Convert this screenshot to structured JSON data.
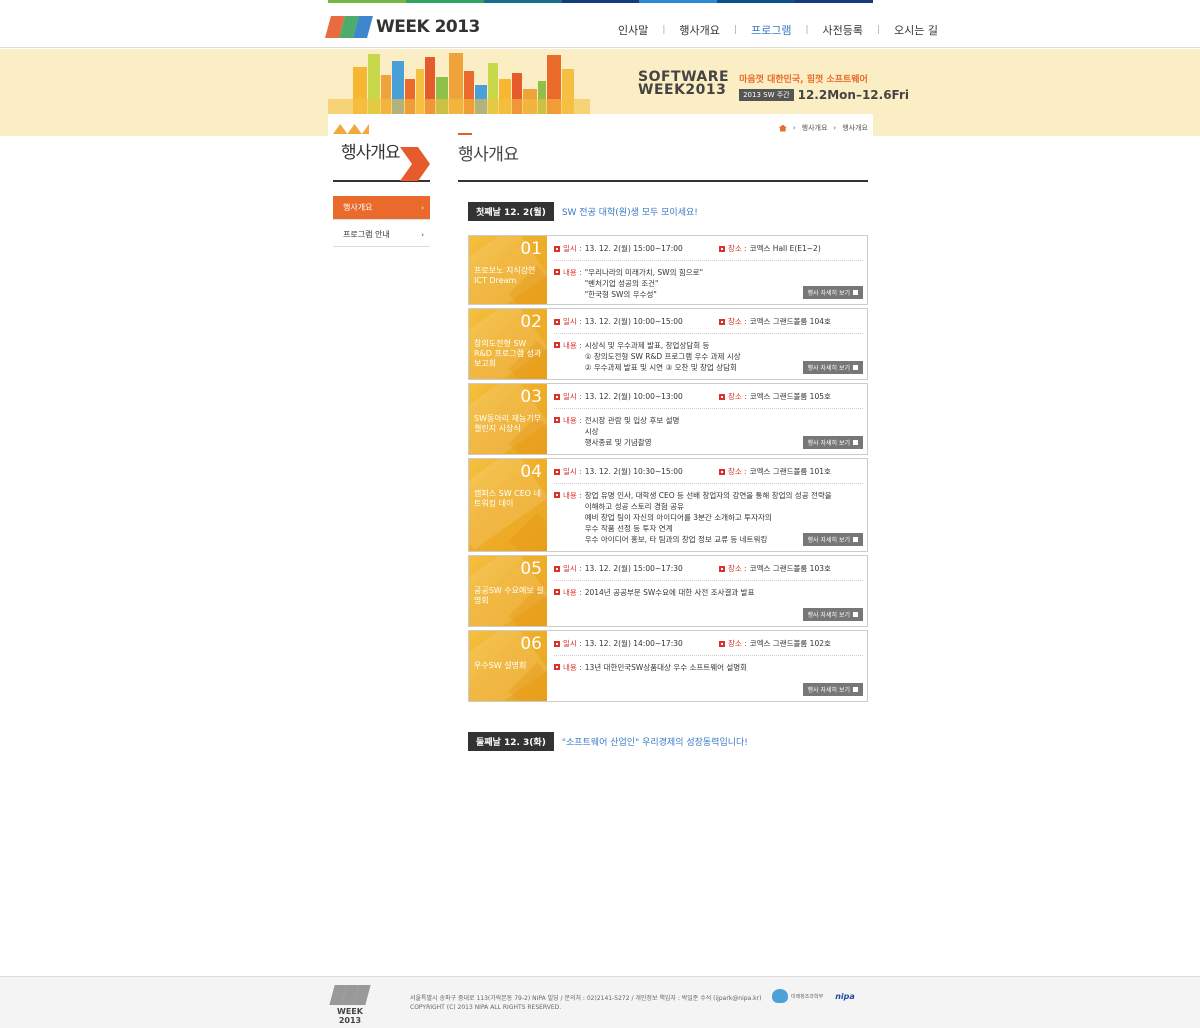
{
  "colors": {
    "accent": "#e96a2b",
    "link_blue": "#3a79c4",
    "label_red": "#d8322a",
    "banner_bg": "#fbeec5",
    "event_yellow": "#f0b02a",
    "strip": [
      "#74b743",
      "#31a45e",
      "#1a6e8c",
      "#133d7a",
      "#2a8bd2",
      "#0d4f8a",
      "#133d7a"
    ]
  },
  "header": {
    "logo_text": "WEEK 2013",
    "nav": [
      {
        "label": "인사말",
        "active": false
      },
      {
        "label": "행사개요",
        "active": false
      },
      {
        "label": "프로그램",
        "active": true
      },
      {
        "label": "사전등록",
        "active": false
      },
      {
        "label": "오시는 길",
        "active": false
      }
    ]
  },
  "banner": {
    "title_line1": "SOFTWARE",
    "title_line2": "WEEK2013",
    "slogan": "마음껏 대한민국, 힘껏 소프트웨어",
    "badge": "2013 SW 주간",
    "date": "12.2Mon–12.6Fri"
  },
  "breadcrumb": {
    "items": [
      "행사개요",
      "행사개요"
    ]
  },
  "lnb": {
    "title": "행사개요",
    "items": [
      {
        "label": "행사개요",
        "active": true
      },
      {
        "label": "프로그램 안내",
        "active": false
      }
    ]
  },
  "main": {
    "page_title": "행사개요",
    "day1": {
      "label": "첫째날 12. 2(월)",
      "subtitle": "SW 전공 대학(원)생 모두 모이세요!"
    },
    "day2": {
      "label": "둘째날 12. 3(화)",
      "subtitle": "\"소프트웨어 산업인\" 우리경제의 성장동력입니다!"
    },
    "labels": {
      "time": "일시 :",
      "place": "장소 :",
      "content": "내용 :",
      "detail": "행사 자세히 보기"
    },
    "events": [
      {
        "num": "01",
        "title": "프로보노 지식강연 ICT Dream",
        "time": "13. 12. 2(월) 15:00~17:00",
        "place": "코엑스 Hall E(E1~2)",
        "lines": [
          "\"우리나라의 미래가치, SW의 힘으로\"",
          "\"벤처기업 성공의 조건\"",
          "\"한국형 SW의 우수성\""
        ]
      },
      {
        "num": "02",
        "title": "창의도전형 SW R&D 프로그램 성과보고회",
        "time": "13. 12. 2(월) 10:00~15:00",
        "place": "코엑스 그랜드볼룸 104호",
        "lines": [
          "시상식 및 우수과제 발표, 창업상담회 등",
          "① 창의도전형 SW R&D 프로그램 우수 과제 시상",
          "② 우수과제 발표 및 시연     ③ 오찬 및 창업 상담회"
        ]
      },
      {
        "num": "03",
        "title": "SW동아리 재능기부 챌린지 시상식",
        "time": "13. 12. 2(월) 10:00~13:00",
        "place": "코엑스 그랜드볼룸 105호",
        "lines": [
          "전시장 관람 및 입상 후보 설명",
          "시상",
          "행사종료 및 기념촬영"
        ]
      },
      {
        "num": "04",
        "title": "캠퍼스 SW CEO 네트워킹 데이",
        "time": "13. 12. 2(월) 10:30~15:00",
        "place": "코엑스 그랜드볼룸 101호",
        "lines": [
          "창업 유명 인사, 대학생 CEO 등 선배 창업자의 강연을 통해 창업의 성공 전략을",
          "이해하고 성공 스토리 경험 공유",
          "예비 창업 팀이 자신의 아이디어를 3분간 소개하고 투자자의",
          "우수 작품 선정 등 투자 연계",
          "우수 아이디어 홍보, 타 팀과의 창업 정보 교류 등 네트워킹"
        ]
      },
      {
        "num": "05",
        "title": "공공SW 수요예보 설명회",
        "time": "13. 12. 2(월) 15:00~17:30",
        "place": "코엑스 그랜드볼룸 103호",
        "lines": [
          "2014년 공공부문 SW수요에 대한 사전 조사결과 발표"
        ]
      },
      {
        "num": "06",
        "title": "우수SW 설명회",
        "time": "13. 12. 2(월) 14:00~17:30",
        "place": "코엑스 그랜드볼룸 102호",
        "lines": [
          "13년 대한민국SW상품대상 우수 소프트웨어 설명회"
        ]
      }
    ]
  },
  "footer": {
    "logo_text": "WEEK 2013",
    "address": "서울특별시 송파구 중대로 113(가락본동 79-2) NIPA 빌딩 / 문의처 : 02)2141-5272 / 개인정보 책임자 : 박일준 수석 (ijpark@nipa.kr)",
    "copyright": "COPYRIGHT (C) 2013 NIPA ALL RIGHTS RESERVED.",
    "org1": "미래창조과학부",
    "org2": "nipa"
  }
}
